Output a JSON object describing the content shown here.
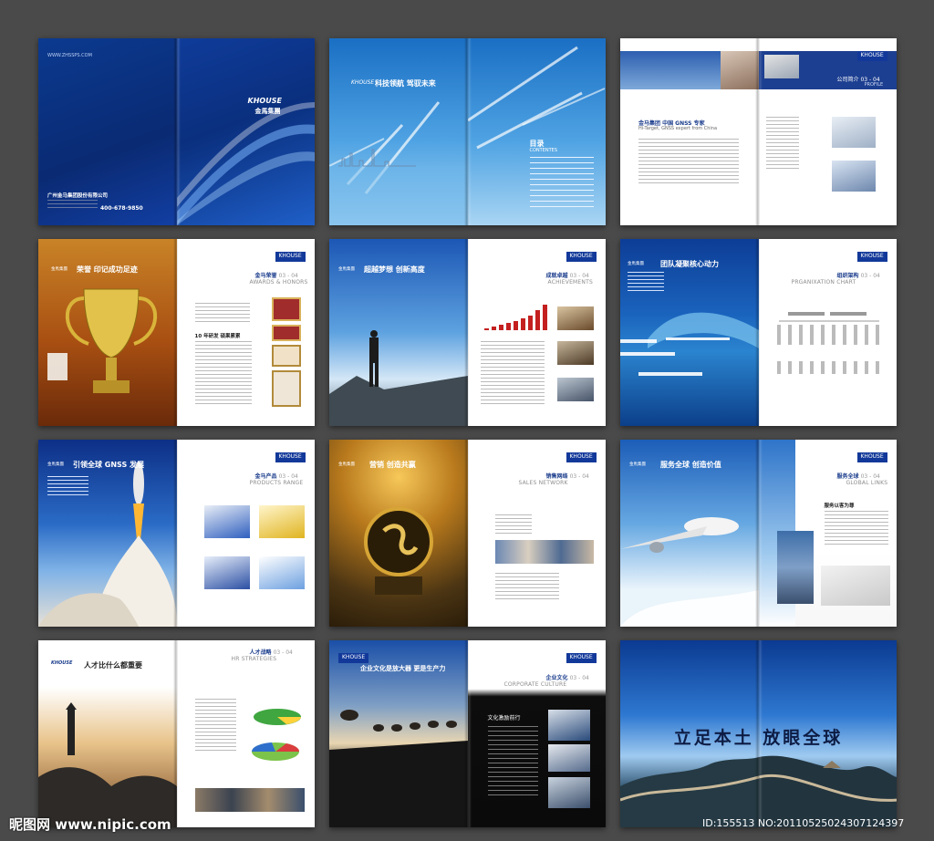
{
  "brand": {
    "en": "KHOUSE",
    "cn": "金馬集團"
  },
  "p1": {
    "url": "WWW.ZHSSPS.COM",
    "company": "广州金马集团股份有限公司",
    "phone": "400-678-9850"
  },
  "p2": {
    "headline": "科技领航  驾驭未来",
    "toc_title": "目录",
    "toc_sub": "CONTENTES"
  },
  "p3": {
    "section": "公司简介",
    "section_num": "03 - 04",
    "section_en": "PROFILE",
    "heading": "金马集团  中国 GNSS 专家",
    "heading_en": "Hi-Target, GNSS expert from China"
  },
  "p4": {
    "headline": "荣誉  印记成功足迹",
    "section": "金马荣誉",
    "section_num": "03 - 04",
    "section_en": "AWARDS & HONORS",
    "item": "10 年研发  硕果累累"
  },
  "p5": {
    "headline": "超越梦想  创新高度",
    "section": "成就卓越",
    "section_num": "03 - 04",
    "section_en": "ACHIEVEMENTS"
  },
  "p6": {
    "headline": "团队凝聚核心动力",
    "section": "组织架构",
    "section_num": "03 - 04",
    "section_en": "PRGANIXATION CHART"
  },
  "p7": {
    "headline": "引领全球 GNSS 发展",
    "section": "金马产品",
    "section_num": "03 - 04",
    "section_en": "PRODUCTS RANGE"
  },
  "p8": {
    "headline": "营销  创造共赢",
    "section": "销售网络",
    "section_num": "03 - 04",
    "section_en": "SALES NETWORK"
  },
  "p9": {
    "headline": "服务全球  创造价值",
    "section": "服务全球",
    "section_num": "03 - 04",
    "section_en": "GLOBAL LINKS",
    "item": "服务以客为尊"
  },
  "p10": {
    "headline": "人才比什么都重要",
    "section": "人才战略",
    "section_num": "03 - 04",
    "section_en": "HR STRATEGIES"
  },
  "p11": {
    "headline": "企业文化是放大器  更是生产力",
    "section": "企业文化",
    "section_num": "03 - 04",
    "section_en": "CORPORATE CULTURE",
    "item": "文化激励前行"
  },
  "p12": {
    "calligraphy": "立足本土  放眼全球"
  },
  "footer": {
    "site": "昵图网 www.nipic.com",
    "id": "ID:155513 NO:20110525024307124397"
  },
  "colors": {
    "background": "#4a4a4a",
    "brand_blue": "#12399a"
  }
}
